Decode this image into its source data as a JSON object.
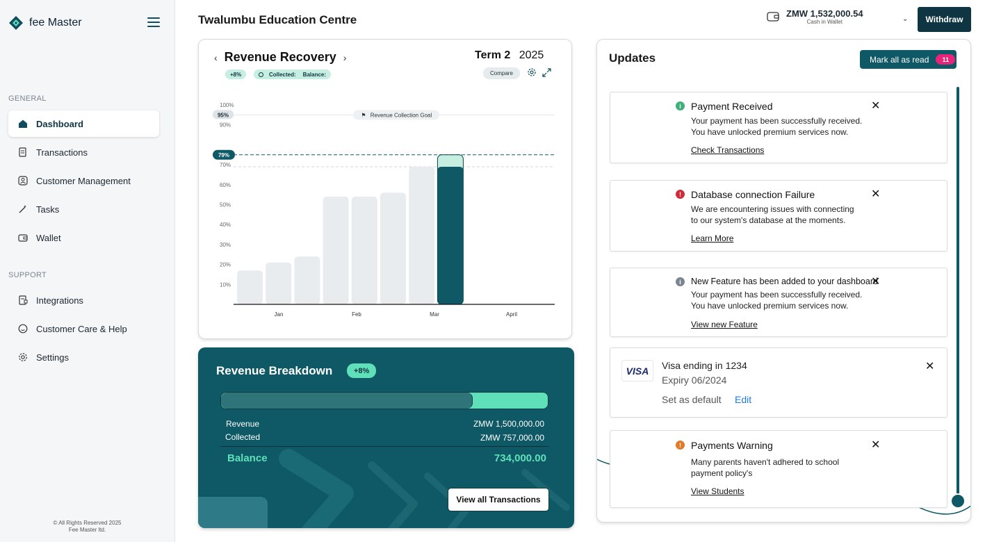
{
  "sidebar": {
    "logo_text": "fee Master",
    "general_label": "GENERAL",
    "support_label": "SUPPORT",
    "items": [
      {
        "label": "Dashboard",
        "icon": "home-icon",
        "active": true
      },
      {
        "label": "Transactions",
        "icon": "receipt-icon"
      },
      {
        "label": "Customer Management",
        "icon": "user-icon"
      },
      {
        "label": "Tasks",
        "icon": "magic-wand-icon"
      },
      {
        "label": "Wallet",
        "icon": "wallet-icon"
      },
      {
        "label": "Integrations",
        "icon": "integration-icon"
      },
      {
        "label": "Customer Care & Help",
        "icon": "chat-icon"
      },
      {
        "label": "Settings",
        "icon": "gear-icon"
      }
    ],
    "footer_line1": "© All Rights Reserved 2025",
    "footer_line2": "Fee Master ltd."
  },
  "header": {
    "school": "Twalumbu Education Centre",
    "wallet_amount": "ZMW 1,532,000.54",
    "wallet_caption": "Cash in Wallet",
    "withdraw_label": "Withdraw"
  },
  "revenue_recovery": {
    "title": "Revenue Recovery",
    "term_label": "Term 2",
    "year": "2025",
    "growth_badge": "+8%",
    "collected_label": "Collected:",
    "balance_label": "Balance:",
    "compare_label": "Compare",
    "goal_label": "Revenue Collection Goal",
    "goal_badge": "95%",
    "current_badge": "79%"
  },
  "chart_data": {
    "type": "bar",
    "categories": [
      "Jan",
      "Feb",
      "Mar",
      "April"
    ],
    "x_tick_labels": [
      "Jan",
      "Feb",
      "Mar",
      "April"
    ],
    "y_tick_labels": [
      "100%",
      "90%",
      "70%",
      "60%",
      "50%",
      "40%",
      "30%",
      "20%",
      "10%"
    ],
    "ylim": [
      0,
      100
    ],
    "bars": [
      {
        "group": "Jan",
        "value": 17
      },
      {
        "group": "Jan",
        "value": 21
      },
      {
        "group": "Jan",
        "value": 24
      },
      {
        "group": "Feb",
        "value": 54
      },
      {
        "group": "Feb",
        "value": 54
      },
      {
        "group": "Feb",
        "value": 56
      },
      {
        "group": "Mar",
        "value": 69
      },
      {
        "group": "Mar",
        "value": 69,
        "highlight": true,
        "projected": 75
      }
    ],
    "goal_line": 95,
    "current_line": 75,
    "reference_line": 69,
    "grid": true,
    "colors": {
      "bar": "#e9ecef",
      "highlight": "#0e5965",
      "projected": "#c6efe2"
    }
  },
  "breakdown": {
    "title": "Revenue Breakdown",
    "badge": "+8%",
    "progress_fraction": 0.77,
    "revenue_label": "Revenue",
    "revenue_value": "ZMW 1,500,000.00",
    "collected_label": "Collected",
    "collected_value": "ZMW 757,000.00",
    "balance_label": "Balance",
    "balance_value": "734,000.00",
    "view_all_label": "View all Transactions"
  },
  "updates": {
    "title": "Updates",
    "mark_all_label": "Mark all as read",
    "unread_count": "11",
    "notices": [
      {
        "title": "Payment Received",
        "line1": "Your payment has been successfully received.",
        "line2": "You have unlocked premium services now.",
        "link": "Check Transactions",
        "icon_color": "#3fb07a"
      },
      {
        "title": "Database connection Failure",
        "line1": "We are encountering issues with connecting",
        "line2": "to our system's database at the moments.",
        "link": "Learn More",
        "icon_color": "#d12a3a"
      },
      {
        "title": "New Feature has been added to your dashboard",
        "line1": "Your payment has been successfully received.",
        "line2": "You have unlocked premium services now.",
        "link": "View new Feature",
        "icon_color": "#7a8591"
      },
      {
        "title": "Payments Warning",
        "line1": "Many parents haven't adhered to school",
        "line2": "payment policy's",
        "link": "View Students",
        "icon_color": "#e27a28"
      }
    ],
    "card": {
      "brand": "VISA",
      "title": "Visa ending in 1234",
      "expiry": "Expiry 06/2024",
      "default_label": "Set as default",
      "edit_label": "Edit"
    }
  }
}
